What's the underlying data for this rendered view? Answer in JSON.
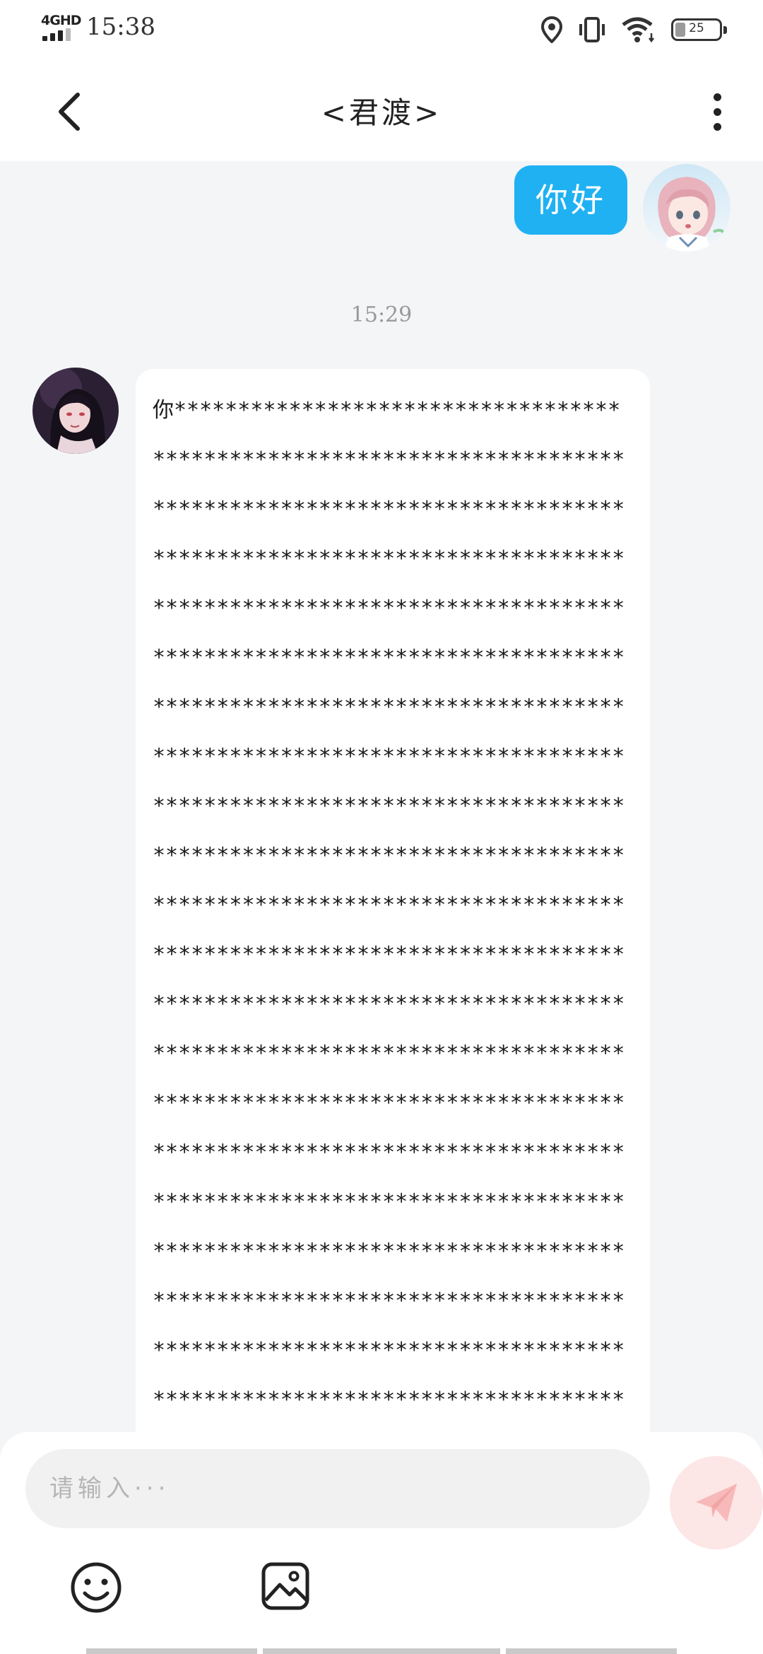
{
  "status_bar": {
    "network": "4GHD",
    "time": "15:38",
    "battery": "25",
    "icons": [
      "location-icon",
      "vibrate-icon",
      "wifi-icon",
      "battery-icon"
    ]
  },
  "header": {
    "title": "<君渡>",
    "back_icon": "chevron-left-icon",
    "more_icon": "more-vertical-icon"
  },
  "messages": [
    {
      "side": "right",
      "text": "你好"
    },
    {
      "side": "left",
      "text": "你*******************************************************************************************************************************************************************************************************************************************************************************************************************************************************************************************************************************************************************************************************************************************************************************************************************************************************************************************************************************************************************************************************************************************************************************************************************************************************************************************"
    }
  ],
  "timestamp": "15:29",
  "input": {
    "placeholder": "请输入···",
    "value": ""
  },
  "toolbar": {
    "emoji_icon": "smiley-icon",
    "image_icon": "image-icon",
    "send_icon": "send-icon"
  },
  "colors": {
    "accent_blue": "#20b1f3",
    "send_disabled_bg": "#fde6e6",
    "send_icon": "#f7b9b9"
  }
}
